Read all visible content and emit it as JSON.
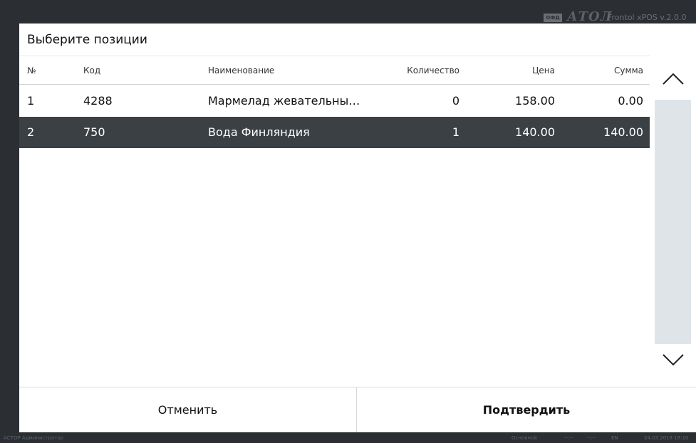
{
  "topbar": {
    "ofd_label": "ОФД",
    "logo": "АТОЛ",
    "version": "Frontol xPOS v.2.0.0"
  },
  "dialog": {
    "title": "Выберите позиции",
    "columns": {
      "num": "№",
      "code": "Код",
      "name": "Наименование",
      "qty": "Количество",
      "price": "Цена",
      "sum": "Сумма"
    },
    "rows": [
      {
        "num": "1",
        "code": "4288",
        "name": "Мармелад жевательны…",
        "qty": "0",
        "price": "158.00",
        "sum": "0.00"
      },
      {
        "num": "2",
        "code": "750",
        "name": "Вода Финляндия",
        "qty": "1",
        "price": "140.00",
        "sum": "140.00"
      }
    ],
    "selected_row": 2,
    "cancel_label": "Отменить",
    "confirm_label": "Подтвердить"
  },
  "scroll": {
    "up_icon": "chevron-up-icon",
    "down_icon": "chevron-down-icon"
  },
  "status": {
    "user": "АСТОР  Администратор",
    "mode": "Основной",
    "f1": "--:--",
    "f2": "--:--",
    "lang": "EN",
    "datetime": "24.03.2018 18:10"
  },
  "colors": {
    "selected_row_bg": "#3b4045",
    "frame_bg": "#2b2f33",
    "scroll_track": "#dfe4e9"
  }
}
